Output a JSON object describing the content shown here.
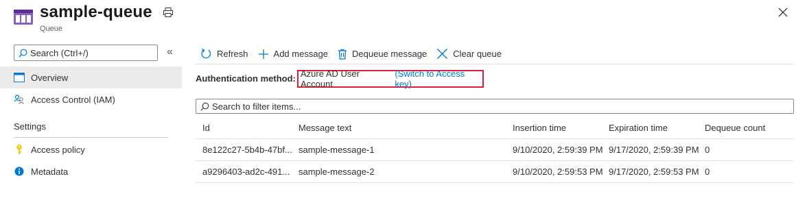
{
  "header": {
    "title": "sample-queue",
    "subtitle": "Queue"
  },
  "sidebar": {
    "search_placeholder": "Search (Ctrl+/)",
    "collapse_glyph": "«",
    "items": [
      {
        "label": "Overview",
        "icon": "overview-icon",
        "active": true
      },
      {
        "label": "Access Control (IAM)",
        "icon": "people-icon",
        "active": false
      }
    ],
    "section": {
      "title": "Settings",
      "items": [
        {
          "label": "Access policy",
          "icon": "key-icon"
        },
        {
          "label": "Metadata",
          "icon": "info-icon"
        }
      ]
    }
  },
  "toolbar": {
    "refresh": "Refresh",
    "add_message": "Add message",
    "dequeue_message": "Dequeue message",
    "clear_queue": "Clear queue"
  },
  "auth": {
    "label": "Authentication method:",
    "value": "Azure AD User Account",
    "switch_link": "(Switch to Access key)",
    "highlight_color": "#e01e3a"
  },
  "filter": {
    "placeholder": "Search to filter items..."
  },
  "table": {
    "columns": [
      "Id",
      "Message text",
      "Insertion time",
      "Expiration time",
      "Dequeue count"
    ],
    "rows": [
      [
        "8e122c27-5b4b-47bf...",
        "sample-message-1",
        "9/10/2020, 2:59:39 PM",
        "9/17/2020, 2:59:39 PM",
        "0"
      ],
      [
        "a9296403-ad2c-491...",
        "sample-message-2",
        "9/10/2020, 2:59:53 PM",
        "9/17/2020, 2:59:53 PM",
        "0"
      ]
    ]
  },
  "colors": {
    "accent": "#0078d4",
    "queue_icon": "#8661c5"
  }
}
